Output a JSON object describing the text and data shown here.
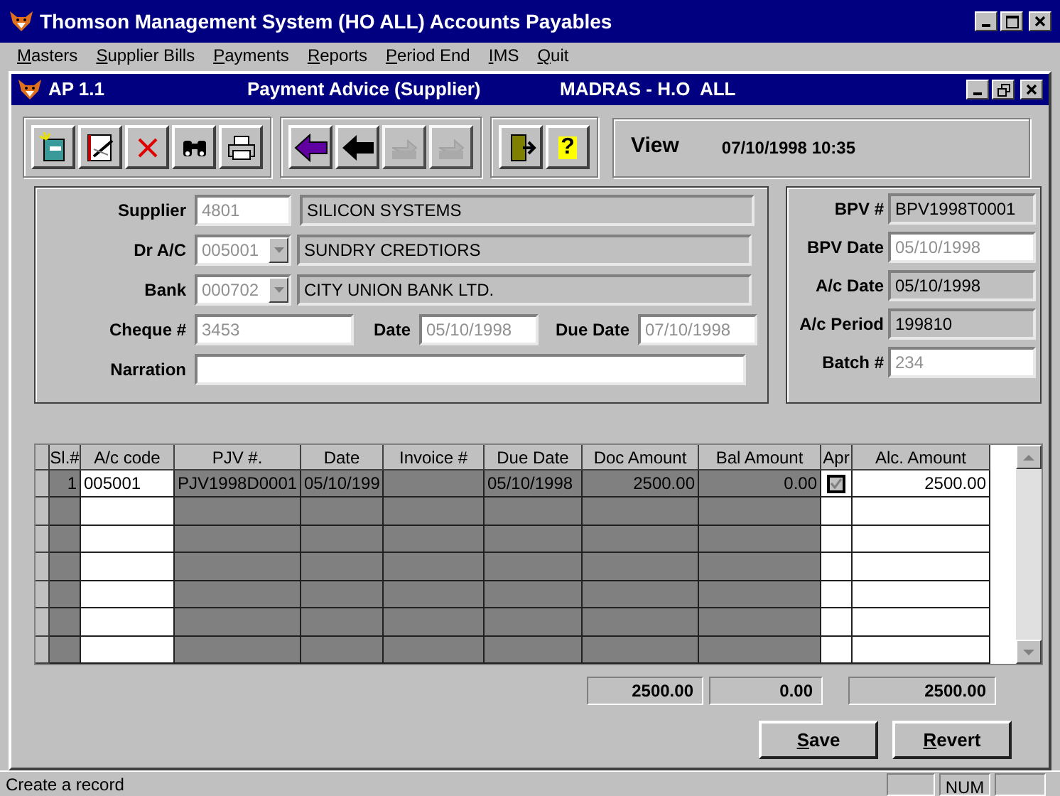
{
  "window": {
    "title": "Thomson Management System (HO ALL) Accounts Payables"
  },
  "menu": [
    "Masters",
    "Supplier Bills",
    "Payments",
    "Reports",
    "Period End",
    "IMS",
    "Quit"
  ],
  "child_window": {
    "code": "AP 1.1",
    "title": "Payment Advice (Supplier)",
    "location": "MADRAS - H.O  ALL"
  },
  "toolbar": [
    [
      {
        "kind": "new",
        "disabled": false
      },
      {
        "kind": "edit",
        "disabled": false
      },
      {
        "kind": "delete",
        "disabled": false
      },
      {
        "kind": "find",
        "disabled": false
      },
      {
        "kind": "print",
        "disabled": false
      }
    ],
    [
      {
        "kind": "first",
        "disabled": false
      },
      {
        "kind": "prev",
        "disabled": false
      },
      {
        "kind": "next",
        "disabled": true
      },
      {
        "kind": "last",
        "disabled": true
      }
    ],
    [
      {
        "kind": "exit",
        "disabled": false
      },
      {
        "kind": "help",
        "label": "?",
        "disabled": false
      }
    ]
  ],
  "mode": "View",
  "datetime": "07/10/1998 10:35",
  "form": {
    "supplier": {
      "label": "Supplier",
      "code": "4801",
      "name": "SILICON SYSTEMS",
      "disabled": true
    },
    "dr_ac": {
      "label": "Dr A/C",
      "code": "005001",
      "name": "SUNDRY CREDTIORS",
      "disabled": true
    },
    "bank": {
      "label": "Bank",
      "code": "000702",
      "name": "CITY UNION BANK LTD.",
      "disabled": true
    },
    "cheque": {
      "label": "Cheque #",
      "value": "3453",
      "disabled": true
    },
    "date": {
      "label": "Date",
      "value": "05/10/1998",
      "disabled": true
    },
    "due_date": {
      "label": "Due Date",
      "value": "07/10/1998",
      "disabled": true
    },
    "narration": {
      "label": "Narration"
    }
  },
  "voucher": [
    {
      "label": "BPV #",
      "value": "BPV1998T0001",
      "disabled": false
    },
    {
      "label": "BPV Date",
      "value": "05/10/1998",
      "disabled": true
    },
    {
      "label": "A/c Date",
      "value": "05/10/1998",
      "disabled": false
    },
    {
      "label": "A/c Period",
      "value": "199810",
      "disabled": false
    },
    {
      "label": "Batch #",
      "value": "234",
      "disabled": true
    }
  ],
  "table": {
    "columns": [
      {
        "label": "Sl.#",
        "shaded": true,
        "kind": "number"
      },
      {
        "label": "A/c code",
        "shaded": false,
        "kind": "text"
      },
      {
        "label": "PJV #.",
        "shaded": true,
        "kind": "text"
      },
      {
        "label": "Date",
        "shaded": true,
        "kind": "text"
      },
      {
        "label": "Invoice #",
        "shaded": true,
        "kind": "text"
      },
      {
        "label": "Due Date",
        "shaded": true,
        "kind": "text"
      },
      {
        "label": "Doc Amount",
        "shaded": true,
        "kind": "number"
      },
      {
        "label": "Bal Amount",
        "shaded": true,
        "kind": "number"
      },
      {
        "label": "Apr",
        "shaded": false,
        "kind": "check"
      },
      {
        "label": "Alc. Amount",
        "shaded": false,
        "kind": "number"
      }
    ],
    "rows": [
      {
        "cells": [
          "1",
          "005001",
          "PJV1998D0001",
          "05/10/199",
          null,
          "05/10/1998",
          "2500.00",
          "0.00",
          null,
          "2500.00"
        ],
        "approved": true
      }
    ]
  },
  "totals": [
    "2500.00",
    "0.00",
    "2500.00"
  ],
  "buttons": [
    "Save",
    "Revert"
  ],
  "status_bar": {
    "message": "Create a record",
    "panes": [
      "NUM"
    ]
  }
}
